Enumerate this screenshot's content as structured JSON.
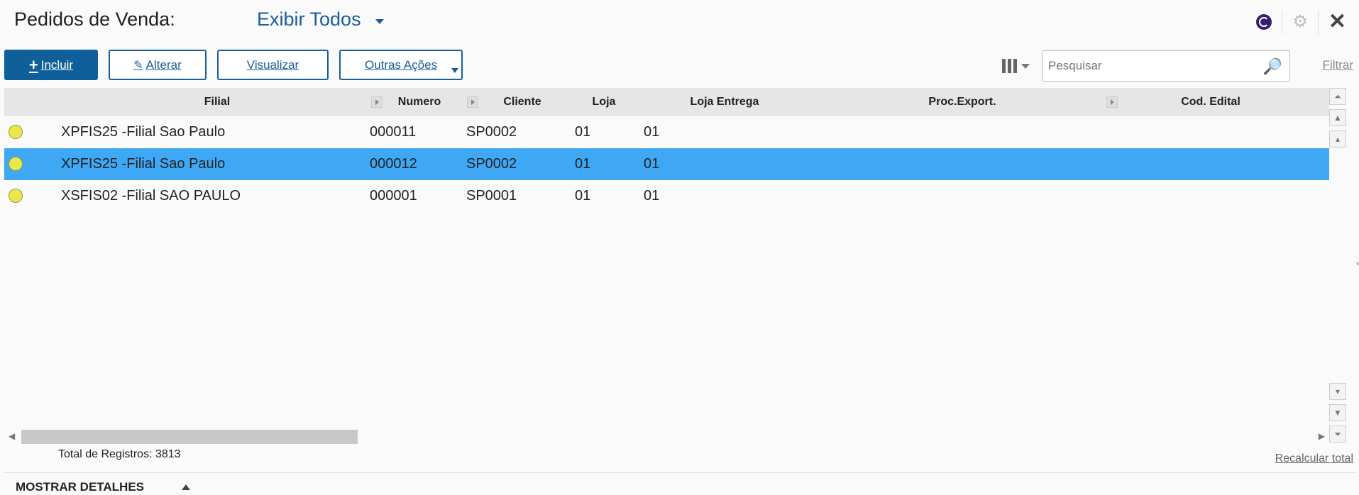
{
  "header": {
    "title": "Pedidos de Venda:",
    "view": "Exibir Todos"
  },
  "toolbar": {
    "incluir": "Incluir",
    "alterar": "Alterar",
    "visualizar": "Visualizar",
    "outras_acoes": "Outras Ações",
    "search_placeholder": "Pesquisar",
    "filtrar": "Filtrar"
  },
  "grid": {
    "columns": [
      "Filial",
      "Numero",
      "Cliente",
      "Loja",
      "Loja Entrega",
      "Proc.Export.",
      "Cod. Edital"
    ],
    "rows": [
      {
        "filial": "XPFIS25 -Filial Sao Paulo",
        "numero": "000011",
        "cliente": "SP0002",
        "loja": "01",
        "loja_entrega": "01",
        "selected": false
      },
      {
        "filial": "XPFIS25 -Filial Sao Paulo",
        "numero": "000012",
        "cliente": "SP0002",
        "loja": "01",
        "loja_entrega": "01",
        "selected": true
      },
      {
        "filial": "XSFIS02 -Filial SAO PAULO",
        "numero": "000001",
        "cliente": "SP0001",
        "loja": "01",
        "loja_entrega": "01",
        "selected": false
      }
    ]
  },
  "footer": {
    "total": "Total de Registros: 3813",
    "recalcular": "Recalcular total",
    "details": "MOSTRAR DETALHES"
  },
  "colors": {
    "accent": "#1a5d9c",
    "selected_row": "#3ea8f5",
    "status_dot": "#e8e84a"
  }
}
